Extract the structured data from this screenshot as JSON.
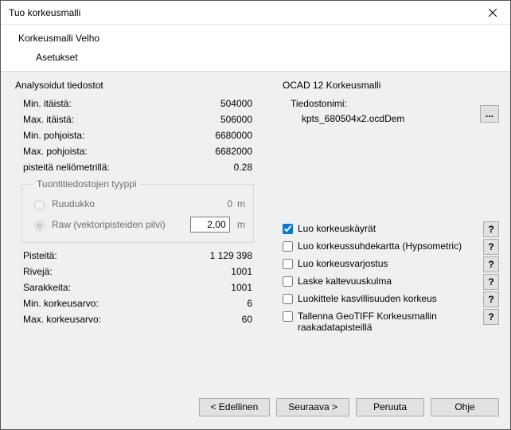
{
  "window": {
    "title": "Tuo korkeusmalli"
  },
  "header": {
    "line1": "Korkeusmalli Velho",
    "line2": "Asetukset"
  },
  "analysis": {
    "title": "Analysoidut tiedostot",
    "min_east_label": "Min. itäistä:",
    "min_east": "504000",
    "max_east_label": "Max. itäistä:",
    "max_east": "506000",
    "min_north_label": "Min. pohjoista:",
    "min_north": "6680000",
    "max_north_label": "Max. pohjoista:",
    "max_north": "6682000",
    "density_label": "pisteitä neliömetrillä:",
    "density": "0.28",
    "import_type_title": "Tuontitiedostojen tyyppi",
    "grid_label": "Ruudukko",
    "grid_val": "0",
    "grid_unit": "m",
    "raw_label": "Raw (vektoripisteiden pilvi)",
    "raw_val": "2,00",
    "raw_unit": "m",
    "points_label": "Pisteitä:",
    "points": "1 129 398",
    "rows_label": "Rivejä:",
    "rows": "1001",
    "cols_label": "Sarakkeita:",
    "cols": "1001",
    "minz_label": "Min. korkeusarvo:",
    "minz": "6",
    "maxz_label": "Max. korkeusarvo:",
    "maxz": "60"
  },
  "right": {
    "title": "OCAD 12 Korkeusmalli",
    "filename_label": "Tiedostonimi:",
    "filename": "kpts_680504x2.ocdDem",
    "ellipsis": "..."
  },
  "checks": {
    "contours": "Luo korkeuskäyrät",
    "hypso": "Luo korkeussuhdekartta (Hypsometric)",
    "shade": "Luo korkeusvarjostus",
    "slope": "Laske kaltevuuskulma",
    "classify": "Luokittele kasvillisuuden korkeus",
    "geotiff": "Tallenna GeoTIFF Korkeusmallin raakadatapisteillä",
    "help": "?"
  },
  "buttons": {
    "prev": "< Edellinen",
    "next": "Seuraava >",
    "cancel": "Peruuta",
    "help": "Ohje"
  }
}
